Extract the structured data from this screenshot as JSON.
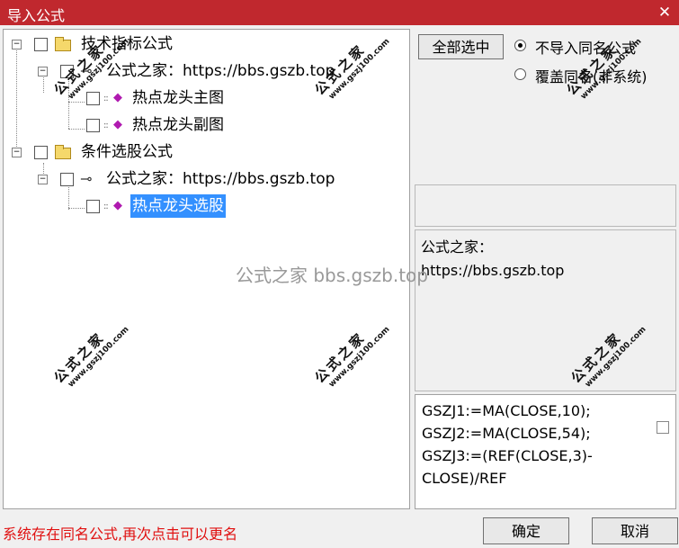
{
  "window": {
    "title": "导入公式",
    "close_glyph": "✕"
  },
  "tree": {
    "nodes": [
      {
        "label": "技术指标公式",
        "icon": "folder-icon"
      },
      {
        "label": "公式之家：https://bbs.gszb.top",
        "icon": "key-icon"
      },
      {
        "label": "热点龙头主图",
        "icon": "formula-gem-icon"
      },
      {
        "label": "热点龙头副图",
        "icon": "formula-gem-icon"
      },
      {
        "label": "条件选股公式",
        "icon": "folder-icon"
      },
      {
        "label": "公式之家：https://bbs.gszb.top",
        "icon": "key-icon"
      },
      {
        "label": "热点龙头选股",
        "icon": "formula-gem-icon",
        "selected": true
      }
    ]
  },
  "right": {
    "select_all_label": "全部选中",
    "radio_options": [
      {
        "label": "不导入同名公式",
        "checked": true
      },
      {
        "label": "覆盖同名(非系统)",
        "checked": false
      }
    ],
    "info_lines": [
      "公式之家：",
      "https://bbs.gszb.top"
    ],
    "code_lines": [
      "GSZJ1:=MA(CLOSE,10);",
      "GSZJ2:=MA(CLOSE,54);",
      "GSZJ3:=(REF(CLOSE,3)-",
      "CLOSE)/REF"
    ]
  },
  "status_text": "系统存在同名公式,再次点击可以更名",
  "buttons": {
    "ok": "确定",
    "cancel": "取消"
  },
  "watermark": {
    "title": "公式之家",
    "url": "www.gszj100.com",
    "center": "公式之家 bbs.gszb.top"
  },
  "colors": {
    "titlebar": "#c0282e",
    "selection": "#3390ff",
    "status": "#e01010",
    "gem": "#b01ab0"
  }
}
